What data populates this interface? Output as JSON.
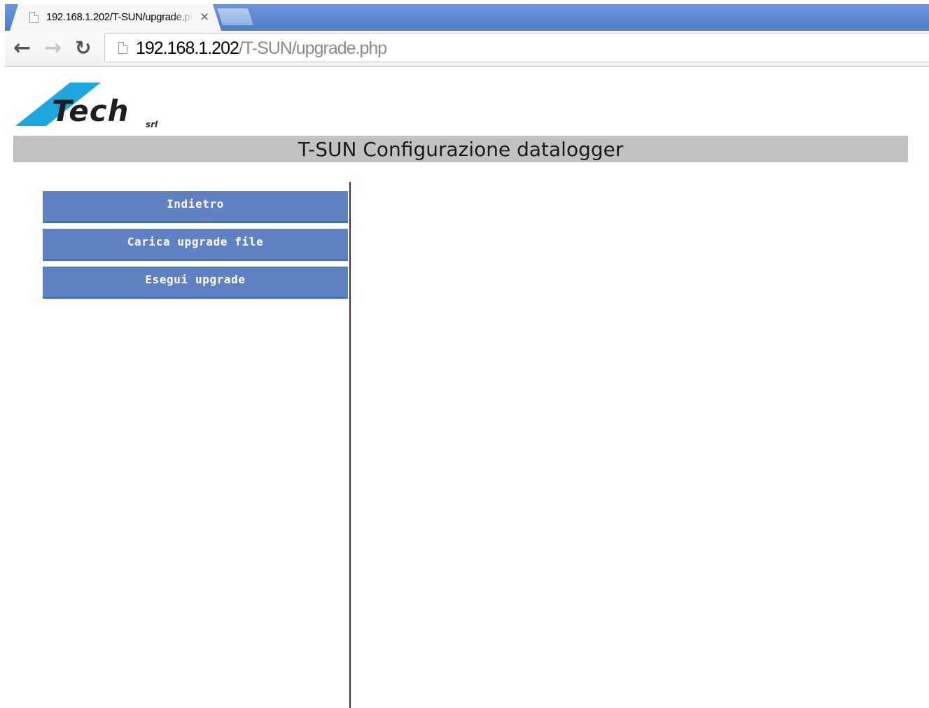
{
  "browser": {
    "tab_title": "192.168.1.202/T-SUN/upgrade.php",
    "tab_close": "×",
    "url_host": "192.168.1.202",
    "url_path": "/T-SUN/upgrade.php",
    "icons": {
      "back": "back-arrow-icon",
      "forward": "forward-arrow-icon",
      "reload": "reload-icon",
      "page": "page-icon"
    }
  },
  "page": {
    "logo": {
      "word": "Tech",
      "suffix": "srl",
      "accent_color": "#1fa6df"
    },
    "title": "T-SUN Configurazione datalogger",
    "menu": [
      {
        "label": "Indietro"
      },
      {
        "label": "Carica upgrade file"
      },
      {
        "label": "Esegui upgrade"
      }
    ],
    "colors": {
      "title_bar": "#c2c2c2",
      "menu_button": "#5f82c5",
      "divider": "#5a2a2a"
    }
  }
}
